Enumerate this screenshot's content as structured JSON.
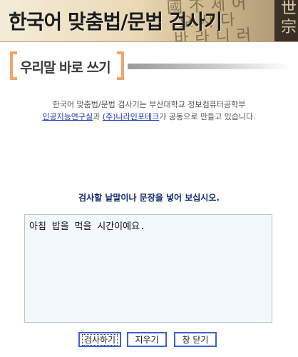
{
  "banner": {
    "title": "한국어 맞춤법/문법 검사기",
    "bg_chars": "國 不 세 어\n  오 사 다\n 바 라 니 러",
    "bg_side": "世\n宗"
  },
  "section": {
    "title": "우리말 바로 쓰기"
  },
  "intro": {
    "line1": "한국어 맞춤법/문법 검사기는 부산대학교 정보컴퓨터공학부",
    "link1": "인공지능연구실",
    "mid": "과 ",
    "link2": "(주)나라인포테크",
    "tail": "가 공동으로 만들고 있습니다."
  },
  "prompt": "검사할 낱말이나 문장을 넣어 보십시오.",
  "textarea": {
    "value": "아침 밥을 먹을 시간이예요."
  },
  "buttons": {
    "check": "검사하기",
    "clear": "지우기",
    "close": "창 닫기"
  },
  "colors": {
    "accent_bracket": "#f0a46c",
    "link": "#1a34b8",
    "prompt": "#102a6e",
    "button_border": "#3e63c8",
    "textarea_bg": "#f3f8fd"
  }
}
